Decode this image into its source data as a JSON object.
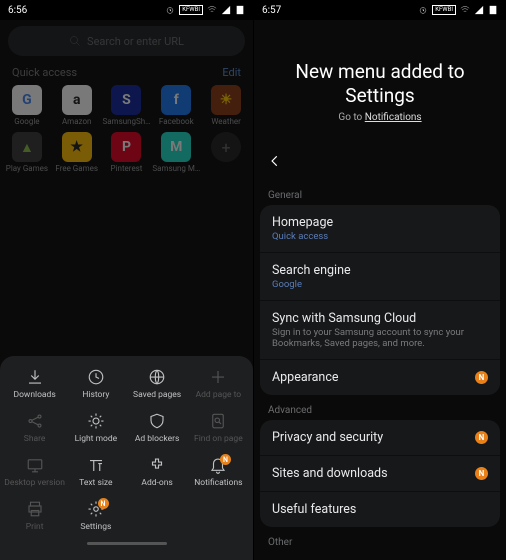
{
  "left": {
    "status_time": "6:56",
    "status_badge": "KFWBI",
    "search_placeholder": "Search or enter URL",
    "quick_access_label": "Quick access",
    "edit_label": "Edit",
    "qa": [
      {
        "label": "Google",
        "bg": "#ffffff",
        "glyph": "G",
        "fgcolor": "#4285f4"
      },
      {
        "label": "Amazon",
        "bg": "#ffffff",
        "glyph": "a",
        "fgcolor": "#222"
      },
      {
        "label": "SamsungSh…",
        "bg": "#1428a0",
        "glyph": "S",
        "fgcolor": "#fff"
      },
      {
        "label": "Facebook",
        "bg": "#1877f2",
        "glyph": "f",
        "fgcolor": "#fff"
      },
      {
        "label": "Weather",
        "bg": "#8a3a13",
        "glyph": "☀",
        "fgcolor": "#ffcc00"
      },
      {
        "label": "Play Games",
        "bg": "#3a3a3a",
        "glyph": "▲",
        "fgcolor": "#8bc34a"
      },
      {
        "label": "Free Games",
        "bg": "#ffc000",
        "glyph": "★",
        "fgcolor": "#222"
      },
      {
        "label": "Pinterest",
        "bg": "#e60023",
        "glyph": "P",
        "fgcolor": "#fff"
      },
      {
        "label": "Samsung M…",
        "bg": "#1ddecb",
        "glyph": "M",
        "fgcolor": "#fff"
      }
    ],
    "sheet": [
      {
        "label": "Downloads",
        "icon": "download",
        "enabled": true
      },
      {
        "label": "History",
        "icon": "clock",
        "enabled": true
      },
      {
        "label": "Saved pages",
        "icon": "globe",
        "enabled": true
      },
      {
        "label": "Add page to",
        "icon": "plus",
        "enabled": false
      },
      {
        "label": "Share",
        "icon": "share",
        "enabled": false
      },
      {
        "label": "Light mode",
        "icon": "sun",
        "enabled": true
      },
      {
        "label": "Ad blockers",
        "icon": "shield",
        "enabled": true
      },
      {
        "label": "Find on page",
        "icon": "search-doc",
        "enabled": false
      },
      {
        "label": "Desktop version",
        "icon": "monitor",
        "enabled": false
      },
      {
        "label": "Text size",
        "icon": "text",
        "enabled": true
      },
      {
        "label": "Add-ons",
        "icon": "puzzle",
        "enabled": true
      },
      {
        "label": "Notifications",
        "icon": "bell",
        "enabled": true,
        "badge": "N"
      },
      {
        "label": "Print",
        "icon": "print",
        "enabled": false
      },
      {
        "label": "Settings",
        "icon": "gear",
        "enabled": true,
        "badge": "N"
      }
    ]
  },
  "right": {
    "status_time": "6:57",
    "status_badge": "KFWBI",
    "hero_title_l1": "New menu added to",
    "hero_title_l2": "Settings",
    "hero_sub_prefix": "Go to ",
    "hero_sub_link": "Notifications",
    "sections": {
      "general": {
        "label": "General",
        "rows": [
          {
            "title": "Homepage",
            "sub": "Quick access",
            "subcolor": "blue"
          },
          {
            "title": "Search engine",
            "sub": "Google",
            "subcolor": "blue"
          },
          {
            "title": "Sync with Samsung Cloud",
            "sub": "Sign in to your Samsung account to sync your Bookmarks, Saved pages, and more.",
            "subcolor": "gray"
          },
          {
            "title": "Appearance",
            "badge": "N"
          }
        ]
      },
      "advanced": {
        "label": "Advanced",
        "rows": [
          {
            "title": "Privacy and security",
            "badge": "N"
          },
          {
            "title": "Sites and downloads",
            "badge": "N"
          },
          {
            "title": "Useful features"
          }
        ]
      },
      "other": {
        "label": "Other"
      }
    }
  }
}
